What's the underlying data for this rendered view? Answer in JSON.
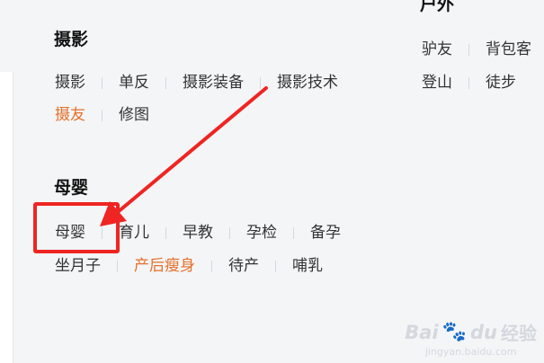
{
  "sections": {
    "outdoor": {
      "title": "户外",
      "row1": [
        "驴友",
        "背包客"
      ],
      "row2": [
        "登山",
        "徒步"
      ]
    },
    "photography": {
      "title": "摄影",
      "row1": [
        "摄影",
        "单反",
        "摄影装备",
        "摄影技术"
      ],
      "row2": [
        "摄友",
        "修图"
      ]
    },
    "maternity": {
      "title": "母婴",
      "row1": [
        "母婴",
        "育儿",
        "早教",
        "孕检",
        "备孕"
      ],
      "row2": [
        "坐月子",
        "产后瘦身",
        "待产",
        "哺乳"
      ]
    }
  },
  "watermark": {
    "brand": "Bai",
    "brand_suffix": "du",
    "paw": "🐾",
    "jingyan": "经验",
    "url": "jingyan.baidu.com"
  },
  "colors": {
    "background": "#f4f5f7",
    "link_text": "#333333",
    "link_highlight": "#e5702a",
    "annotation_red": "#ee2522"
  }
}
